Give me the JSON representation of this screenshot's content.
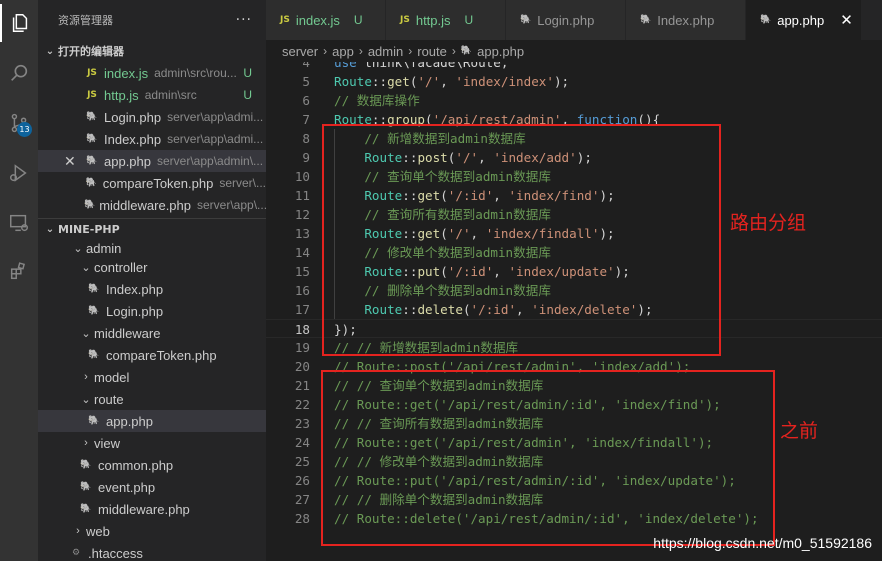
{
  "activity_bar": {
    "icons": [
      "explorer-icon",
      "search-icon",
      "source-control-icon",
      "run-debug-icon",
      "remote-explorer-icon",
      "extensions-icon"
    ],
    "scm_badge": "13"
  },
  "sidebar": {
    "title": "资源管理器",
    "more": "···",
    "open_editors": {
      "label": "打开的编辑器",
      "items": [
        {
          "name": "index.js",
          "desc": "admin\\src\\rou...",
          "status": "U",
          "type": "js"
        },
        {
          "name": "http.js",
          "desc": "admin\\src",
          "status": "U",
          "type": "js"
        },
        {
          "name": "Login.php",
          "desc": "server\\app\\admi...",
          "status": "",
          "type": "php"
        },
        {
          "name": "Index.php",
          "desc": "server\\app\\admi...",
          "status": "",
          "type": "php"
        },
        {
          "name": "app.php",
          "desc": "server\\app\\admin\\...",
          "status": "",
          "type": "php"
        },
        {
          "name": "compareToken.php",
          "desc": "server\\...",
          "status": "",
          "type": "php"
        },
        {
          "name": "middleware.php",
          "desc": "server\\app\\...",
          "status": "",
          "type": "php"
        }
      ]
    },
    "project": {
      "label": "MINE-PHP",
      "admin": "admin",
      "controller": "controller",
      "index_php": "Index.php",
      "login_php": "Login.php",
      "middleware_dir": "middleware",
      "compare_php": "compareToken.php",
      "model": "model",
      "route": "route",
      "app_php": "app.php",
      "view": "view",
      "common_php": "common.php",
      "event_php": "event.php",
      "middleware_php": "middleware.php",
      "web": "web",
      "htaccess": ".htaccess"
    }
  },
  "tabs": [
    {
      "name": "index.js",
      "status": "U",
      "type": "js",
      "active": false
    },
    {
      "name": "http.js",
      "status": "U",
      "type": "js",
      "active": false
    },
    {
      "name": "Login.php",
      "status": "",
      "type": "php",
      "active": false
    },
    {
      "name": "Index.php",
      "status": "",
      "type": "php",
      "active": false
    },
    {
      "name": "app.php",
      "status": "",
      "type": "php",
      "active": true
    }
  ],
  "breadcrumb": [
    "server",
    "app",
    "admin",
    "route",
    "app.php"
  ],
  "editor": {
    "current_line": 18,
    "lines": [
      {
        "n": 4,
        "text": "use think\\facade\\Route;"
      },
      {
        "n": 5,
        "text": "Route::get('/', 'index/index');"
      },
      {
        "n": 6,
        "text": "// 数据库操作"
      },
      {
        "n": 7,
        "text": "Route::group('/api/rest/admin', function(){"
      },
      {
        "n": 8,
        "text": "    // 新增数据到admin数据库"
      },
      {
        "n": 9,
        "text": "    Route::post('/', 'index/add');"
      },
      {
        "n": 10,
        "text": "    // 查询单个数据到admin数据库"
      },
      {
        "n": 11,
        "text": "    Route::get('/:id', 'index/find');"
      },
      {
        "n": 12,
        "text": "    // 查询所有数据到admin数据库"
      },
      {
        "n": 13,
        "text": "    Route::get('/', 'index/findall');"
      },
      {
        "n": 14,
        "text": "    // 修改单个数据到admin数据库"
      },
      {
        "n": 15,
        "text": "    Route::put('/:id', 'index/update');"
      },
      {
        "n": 16,
        "text": "    // 删除单个数据到admin数据库"
      },
      {
        "n": 17,
        "text": "    Route::delete('/:id', 'index/delete');"
      },
      {
        "n": 18,
        "text": "});"
      },
      {
        "n": 19,
        "text": "// // 新增数据到admin数据库"
      },
      {
        "n": 20,
        "text": "// Route::post('/api/rest/admin', 'index/add');"
      },
      {
        "n": 21,
        "text": "// // 查询单个数据到admin数据库"
      },
      {
        "n": 22,
        "text": "// Route::get('/api/rest/admin/:id', 'index/find');"
      },
      {
        "n": 23,
        "text": "// // 查询所有数据到admin数据库"
      },
      {
        "n": 24,
        "text": "// Route::get('/api/rest/admin', 'index/findall');"
      },
      {
        "n": 25,
        "text": "// // 修改单个数据到admin数据库"
      },
      {
        "n": 26,
        "text": "// Route::put('/api/rest/admin/:id', 'index/update');"
      },
      {
        "n": 27,
        "text": "// // 删除单个数据到admin数据库"
      },
      {
        "n": 28,
        "text": "// Route::delete('/api/rest/admin/:id', 'index/delete');"
      }
    ]
  },
  "annotations": {
    "group_label": "路由分组",
    "before_label": "之前",
    "color": "#e4231f"
  },
  "watermark": "https://blog.csdn.net/m0_51592186",
  "colors": {
    "keyword": "#569cd6",
    "class": "#4ec9b0",
    "function": "#dcdcaa",
    "string": "#ce9178",
    "comment": "#6a9955",
    "untracked": "#73c991"
  }
}
